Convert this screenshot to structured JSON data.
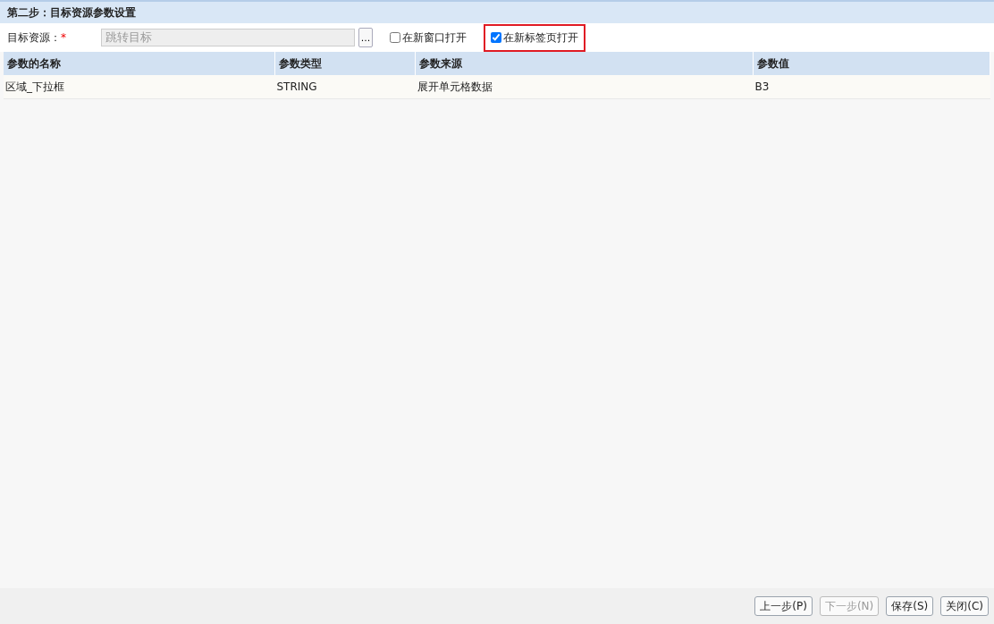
{
  "panel_title": "第二步：目标资源参数设置",
  "target": {
    "label": "目标资源：",
    "required_mark": "*",
    "value": "跳转目标",
    "disabled": true,
    "browse_button": "..."
  },
  "options": [
    {
      "label": "在新窗口打开",
      "checked": false,
      "highlighted": false
    },
    {
      "label": "在新标签页打开",
      "checked": true,
      "highlighted": true
    }
  ],
  "table": {
    "columns": [
      "参数的名称",
      "参数类型",
      "参数来源",
      "参数值"
    ],
    "rows": [
      [
        "区域_下拉框",
        "STRING",
        "展开单元格数据",
        "B3"
      ]
    ]
  },
  "buttons": [
    {
      "label": "上一步(P)",
      "disabled": false
    },
    {
      "label": "下一步(N)",
      "disabled": true
    },
    {
      "label": "保存(S)",
      "disabled": false
    },
    {
      "label": "关闭(C)",
      "disabled": false
    }
  ]
}
